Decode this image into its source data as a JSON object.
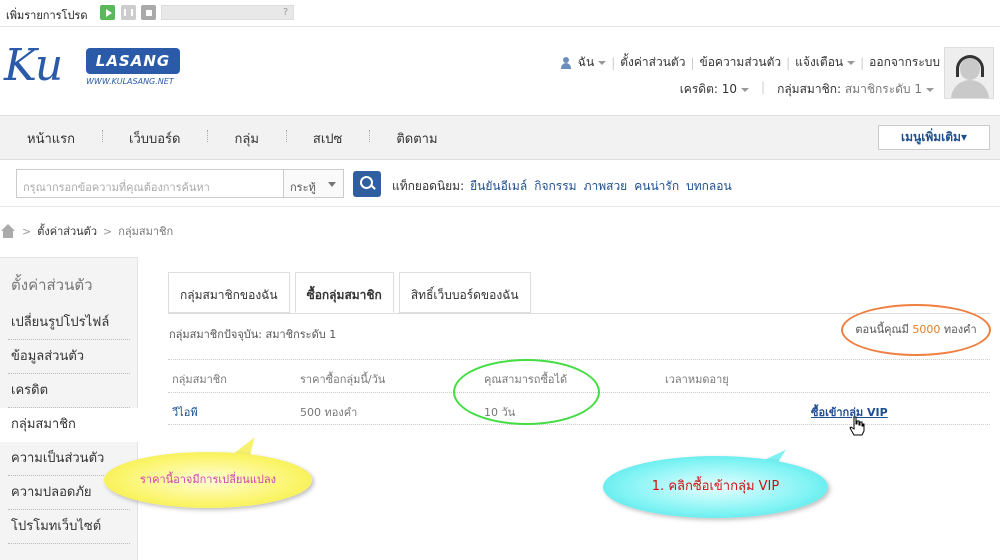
{
  "topstrip": {
    "text": "เพิ่มรายการโปรด",
    "help": "?"
  },
  "logo": {
    "ku": "Ku",
    "brand": "LASANG",
    "url": "WWW.KULASANG.NET"
  },
  "usernav": {
    "me": "ฉัน",
    "items": [
      "ตั้งค่าส่วนตัว",
      "ข้อความส่วนตัว",
      "แจ้งเตือน",
      "ออกจากระบบ"
    ]
  },
  "account": {
    "credit_label": "เครดิต:",
    "credit_value": "10",
    "group_label": "กลุ่มสมาชิก:",
    "group_value": "สมาชิกระดับ 1"
  },
  "mainnav": {
    "items": [
      "หน้าแรก",
      "เว็บบอร์ด",
      "กลุ่ม",
      "สเปซ",
      "ติดตาม"
    ],
    "more": "เมนูเพิ่มเติม▾"
  },
  "search": {
    "placeholder": "กรุณากรอกข้อความที่คุณต้องการค้นหา",
    "scope": "กระทู้",
    "tags_label": "แท็กยอดนิยม:",
    "tags": [
      "ยืนยันอีเมล์",
      "กิจกรรม",
      "ภาพสวย",
      "คนน่ารัก",
      "บทกลอน"
    ]
  },
  "breadcrumb": {
    "level1": "ตั้งค่าส่วนตัว",
    "level2": "กลุ่มสมาชิก"
  },
  "sidebar": {
    "title": "ตั้งค่าส่วนตัว",
    "items": [
      "เปลี่ยนรูปโปรไฟล์",
      "ข้อมูลส่วนตัว",
      "เครดิต",
      "กลุ่มสมาชิก",
      "ความเป็นส่วนตัว",
      "ความปลอดภัย",
      "โปรโมทเว็บไซต์"
    ],
    "active_index": 3
  },
  "tabs": [
    "กลุ่มสมาชิกของฉัน",
    "ซื้อกลุ่มสมาชิก",
    "สิทธิ์เว็บบอร์ดของฉัน"
  ],
  "current_group": "กลุ่มสมาชิกปัจจุบัน: สมาชิกระดับ 1",
  "balance": {
    "prefix": "ตอนนี้คุณมี",
    "amount": "5000",
    "unit": "ทองคำ"
  },
  "table": {
    "headers": [
      "กลุ่มสมาชิก",
      "ราคาซื้อกลุ่มนี้/วัน",
      "คุณสามารถซื้อได้",
      "เวลาหมดอายุ",
      ""
    ],
    "rows": [
      {
        "group": "วีไอพี",
        "price": "500 ทองคำ",
        "can_buy": "10 วัน",
        "expiry": "",
        "action": "ซื้อเข้ากลุ่ม VIP"
      }
    ]
  },
  "callouts": {
    "price_note": "ราคานี้อาจมีการเปลี่ยนแปลง",
    "step1": "1. คลิกซื้อเข้ากลุ่ม VIP"
  },
  "colors": {
    "accent": "#2a5aa8",
    "link": "#1f4f8f",
    "balance_ring": "#f08040",
    "green_ring": "#44dd44",
    "callout_yellow": "#fbf56a",
    "callout_cyan": "#7ff3f4"
  }
}
